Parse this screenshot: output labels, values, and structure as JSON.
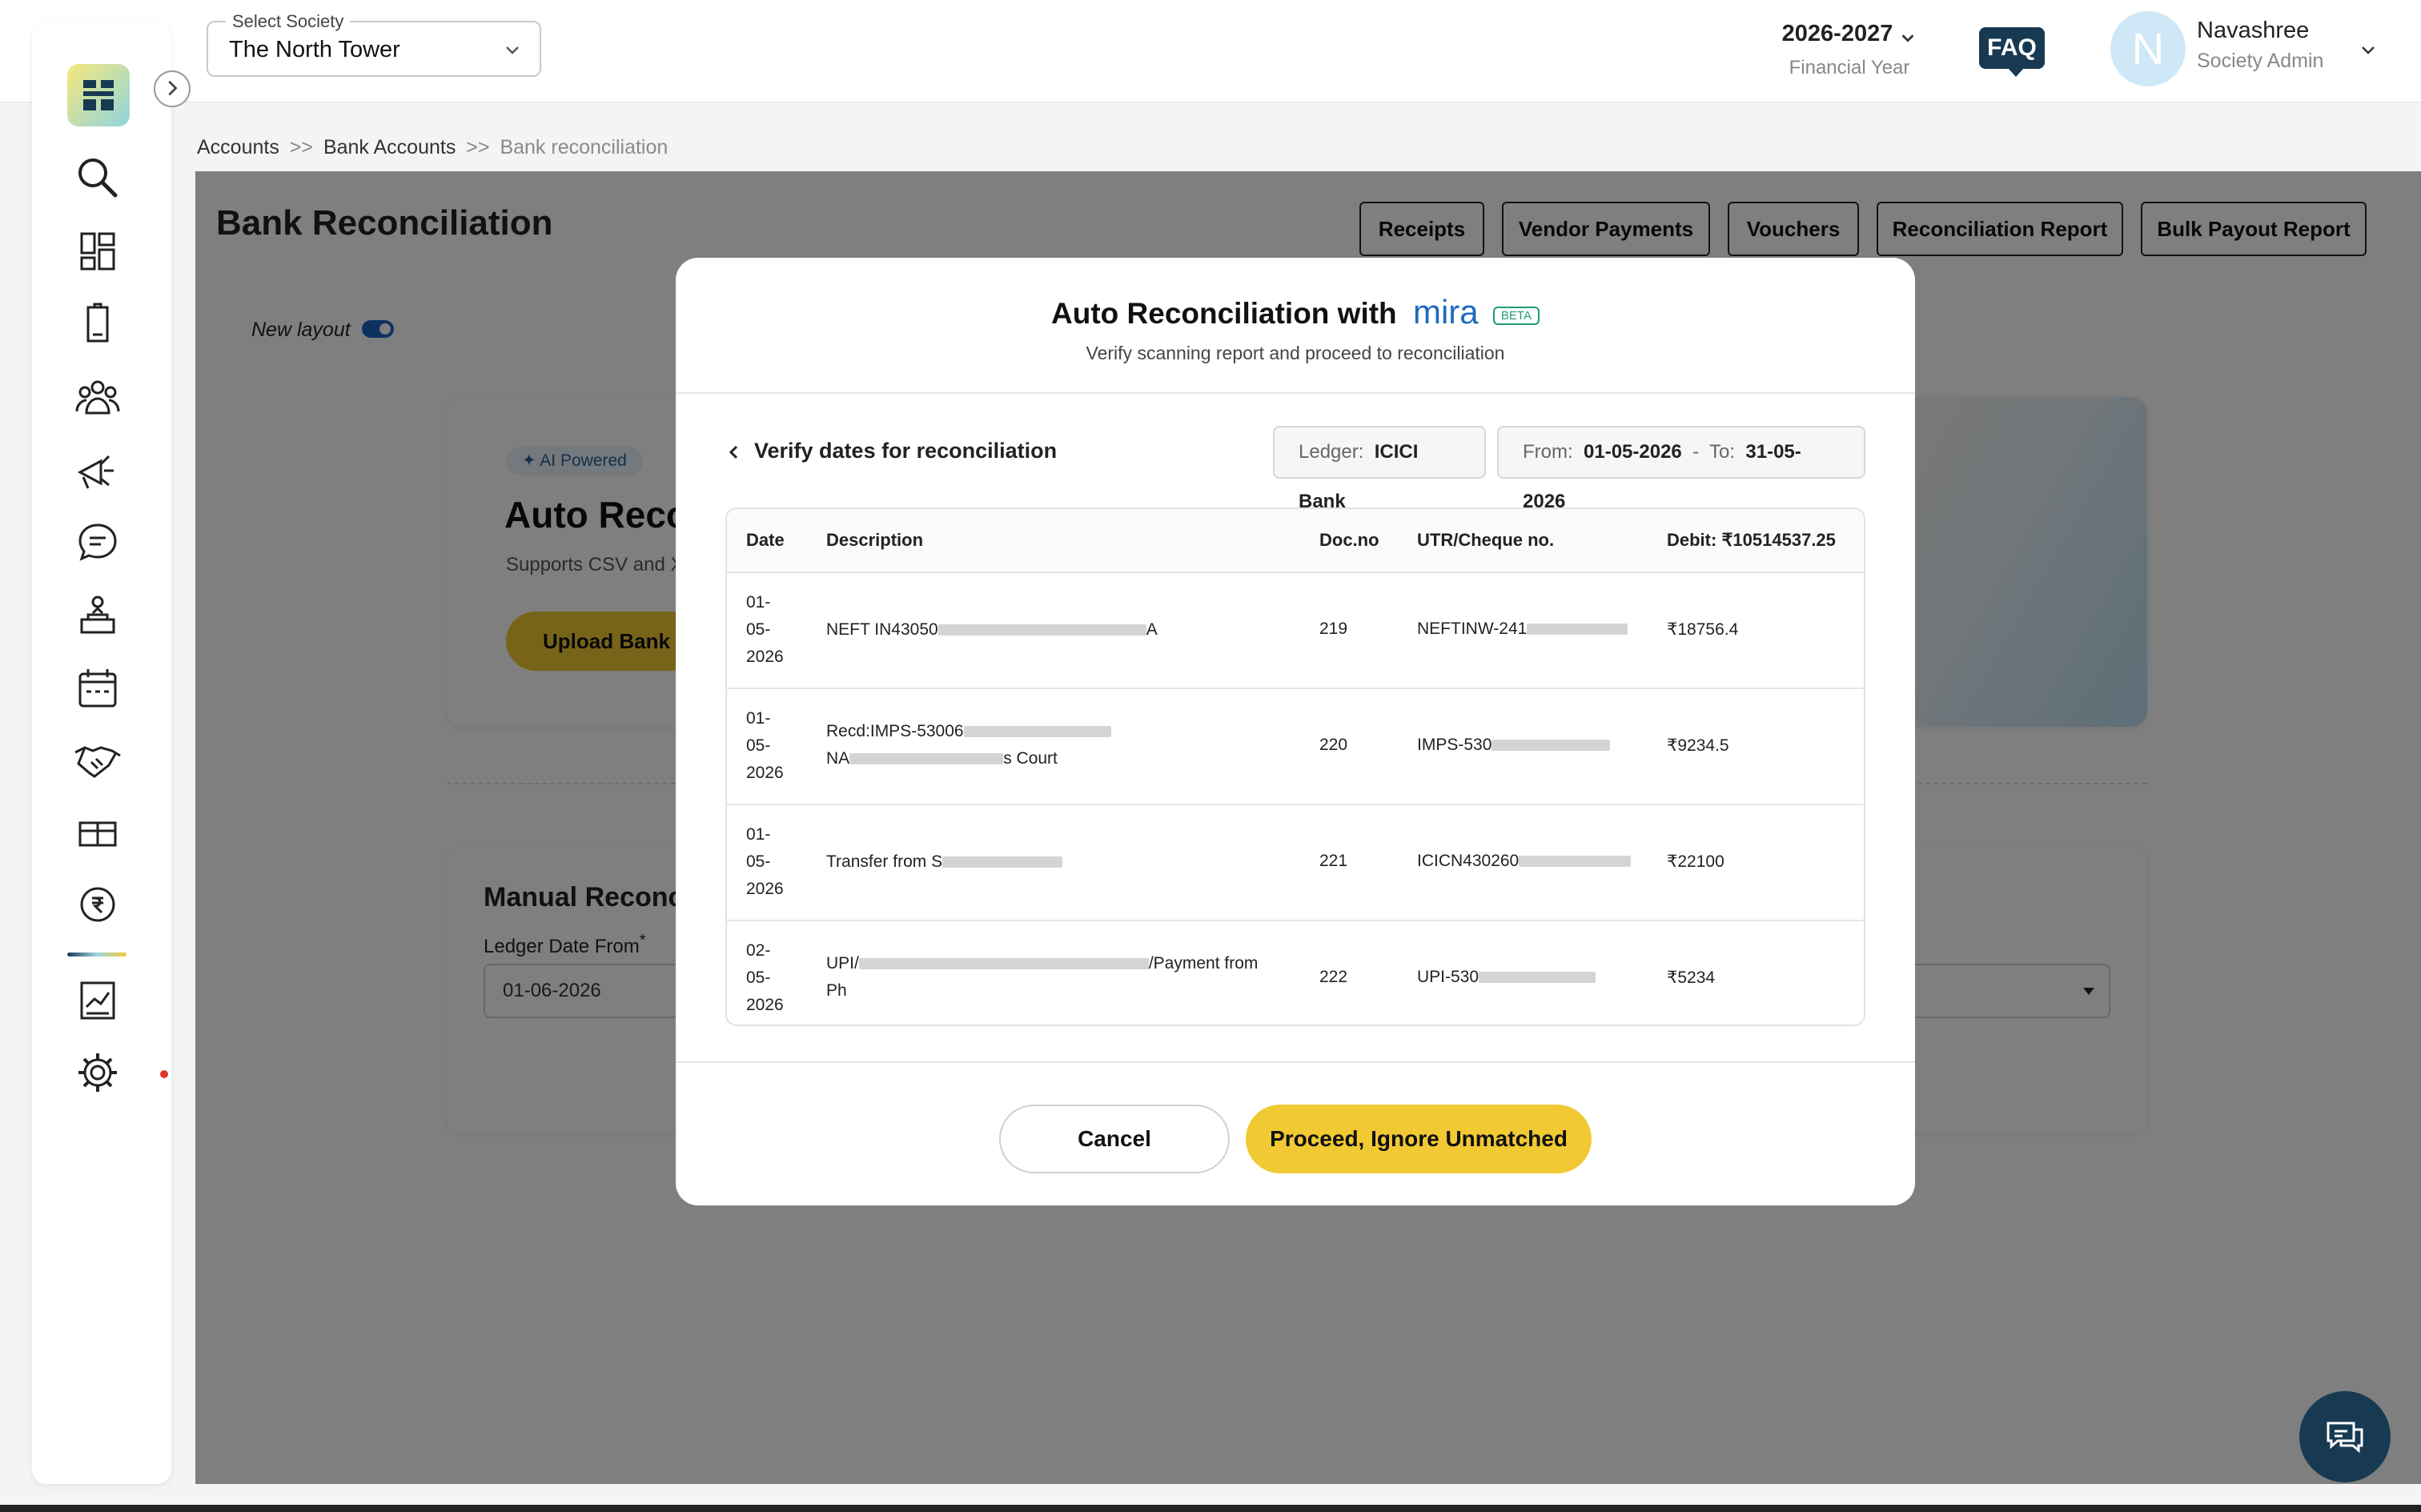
{
  "header": {
    "society_label": "Select Society",
    "society_value": "The North Tower",
    "financial_year": "2026-2027",
    "financial_year_label": "Financial Year",
    "faq_label": "FAQ",
    "avatar_initial": "N",
    "user_name": "Navashree",
    "user_role": "Society Admin"
  },
  "sidebar": {
    "icons": [
      "search-icon",
      "dashboard-icon",
      "building-icon",
      "members-icon",
      "announcement-icon",
      "chat-icon",
      "helpdesk-icon",
      "calendar-icon",
      "handshake-icon",
      "amenities-icon",
      "accounts-icon",
      "reports-icon",
      "settings-icon"
    ],
    "active": "accounts-icon"
  },
  "breadcrumb": {
    "items": [
      "Accounts",
      "Bank Accounts",
      "Bank reconciliation"
    ],
    "separator": ">>"
  },
  "page": {
    "title": "Bank Reconciliation",
    "buttons": [
      "Receipts",
      "Vendor Payments",
      "Vouchers",
      "Reconciliation Report",
      "Bulk Payout Report"
    ],
    "new_layout_label": "New layout",
    "ai_badge": "AI Powered",
    "auto_title": "Auto Recon",
    "auto_sub": "Supports CSV and XL",
    "upload_label": "Upload Bank S",
    "manual_title": "Manual Reconci",
    "ledger_date_label": "Ledger Date From",
    "ledger_date_value": "01-06-2026"
  },
  "modal": {
    "title": "Auto Reconciliation with",
    "brand": "mira",
    "badge": "BETA",
    "subtitle": "Verify scanning report and proceed to reconciliation",
    "back_label": "Verify dates for reconciliation",
    "ledger_label": "Ledger:",
    "ledger_value": "ICICI Bank",
    "from_label": "From:",
    "from_value": "01-05-2026",
    "range_dash": "-",
    "to_label": "To:",
    "to_value": "31-05-2026",
    "columns": [
      "Date",
      "Description",
      "Doc.no",
      "UTR/Cheque no.",
      "Debit: ₹10514537.25"
    ],
    "rows": [
      {
        "date": [
          "01-",
          "05-",
          "2026"
        ],
        "desc_lines": [
          [
            "NEFT IN43050",
            "A"
          ]
        ],
        "doc": "219",
        "utr": "NEFTINW-241",
        "debit": "₹18756.4"
      },
      {
        "date": [
          "01-",
          "05-",
          "2026"
        ],
        "desc_lines": [
          [
            "Recd:IMPS-53006",
            ""
          ],
          [
            "NA",
            "s Court"
          ]
        ],
        "doc": "220",
        "utr": "IMPS-530",
        "debit": "₹9234.5"
      },
      {
        "date": [
          "01-",
          "05-",
          "2026"
        ],
        "desc_lines": [
          [
            "Transfer from S",
            ""
          ]
        ],
        "doc": "221",
        "utr": "ICICN430260",
        "debit": "₹22100"
      },
      {
        "date": [
          "02-",
          "05-",
          "2026"
        ],
        "desc_lines": [
          [
            "UPI/",
            "/Payment from"
          ],
          [
            "Ph",
            ""
          ]
        ],
        "doc": "222",
        "utr": "UPI-530",
        "debit": "₹5234"
      }
    ],
    "cancel_label": "Cancel",
    "proceed_label": "Proceed, Ignore Unmatched"
  },
  "colors": {
    "accent_yellow": "#f1c933",
    "navy": "#173a52",
    "brand_blue": "#1e6bbd"
  }
}
